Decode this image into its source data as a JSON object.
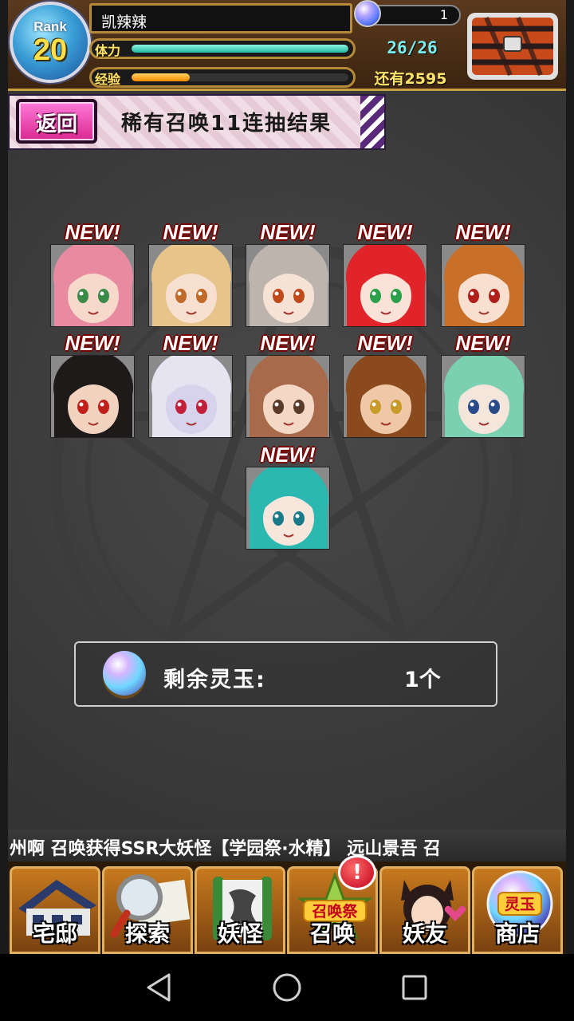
{
  "player": {
    "name": "凯辣辣",
    "rank_label": "Rank",
    "rank": "20",
    "stamina_label": "体力",
    "stamina_text": "26/26",
    "stamina_fraction": 1.0,
    "exp_label": "经验",
    "exp_fraction": 0.27,
    "exp_remaining": "还有2595",
    "gems": "1"
  },
  "header": {
    "back_label": "返回",
    "title": "稀有召唤11连抽结果"
  },
  "results": {
    "new_label": "NEW!",
    "cards": [
      {
        "hair": "#e88aa0",
        "skin": "#f7d9cc",
        "eyes": "#3a8a4a"
      },
      {
        "hair": "#e6c48a",
        "skin": "#f8e0d0",
        "eyes": "#c06a2a"
      },
      {
        "hair": "#bdb5ad",
        "skin": "#f7e2d6",
        "eyes": "#c04a1a"
      },
      {
        "hair": "#e0242a",
        "skin": "#fbe2d8",
        "eyes": "#2aa04a"
      },
      {
        "hair": "#c8702a",
        "skin": "#f9dfcf",
        "eyes": "#b0201a"
      },
      {
        "hair": "#1e1a1a",
        "skin": "#f2d3c0",
        "eyes": "#c0201a"
      },
      {
        "hair": "#e6e4f0",
        "skin": "#d8d3ec",
        "eyes": "#c0203a"
      },
      {
        "hair": "#a86a4a",
        "skin": "#f4d8c6",
        "eyes": "#5a3a2a"
      },
      {
        "hair": "#8a4a1e",
        "skin": "#efc8a8",
        "eyes": "#c89a2a"
      },
      {
        "hair": "#7ad0b0",
        "skin": "#f5e6dc",
        "eyes": "#2a4a8a"
      },
      {
        "hair": "#2ab8b0",
        "skin": "#f7e6dc",
        "eyes": "#1a7a8a"
      }
    ]
  },
  "remaining": {
    "label": "剩余灵玉:",
    "value": "1个"
  },
  "ticker": {
    "text": "州啊 召唤获得SSR大妖怪【学园祭·水精】   远山景吾 召"
  },
  "nav": {
    "items": [
      {
        "label": "宅邸",
        "icon": "mansion-icon"
      },
      {
        "label": "探索",
        "icon": "magnifier-map-icon"
      },
      {
        "label": "妖怪",
        "icon": "scroll-icon"
      },
      {
        "label": "召唤",
        "icon": "summon-festival-icon"
      },
      {
        "label": "妖友",
        "icon": "catgirl-friend-icon"
      },
      {
        "label": "商店",
        "icon": "spirit-jade-icon"
      }
    ],
    "summon_badge": "!",
    "summon_sub": "召唤祭",
    "shop_sub": "灵玉"
  },
  "colors": {
    "accent_gold": "#ffe46a",
    "stamina": "#23b8a0",
    "exp": "#ff8a00",
    "back_button": "#d9288f"
  }
}
